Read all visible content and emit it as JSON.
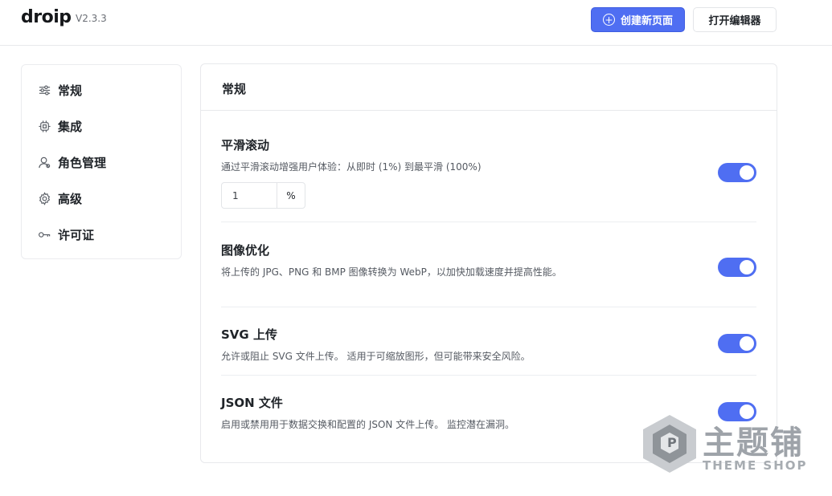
{
  "header": {
    "logo": "droip",
    "version": "V2.3.3",
    "create_page_label": "创建新页面",
    "open_editor_label": "打开编辑器"
  },
  "sidebar": {
    "items": [
      {
        "label": "常规",
        "icon": "sliders-icon"
      },
      {
        "label": "集成",
        "icon": "chip-icon"
      },
      {
        "label": "角色管理",
        "icon": "user-icon"
      },
      {
        "label": "高级",
        "icon": "gear-icon"
      },
      {
        "label": "许可证",
        "icon": "key-icon"
      }
    ]
  },
  "main": {
    "title": "常规",
    "settings": [
      {
        "title": "平滑滚动",
        "description": "通过平滑滚动增强用户体验：从即时 (1%) 到最平滑 (100%)",
        "enabled": true,
        "input_value": "1",
        "input_unit": "%"
      },
      {
        "title": "图像优化",
        "description": "将上传的 JPG、PNG 和 BMP 图像转换为 WebP，以加快加载速度并提高性能。",
        "enabled": true
      },
      {
        "title": "SVG 上传",
        "description": "允许或阻止 SVG 文件上传。 适用于可缩放图形，但可能带来安全风险。",
        "enabled": true
      },
      {
        "title": "JSON 文件",
        "description": "启用或禁用用于数据交换和配置的 JSON 文件上传。 监控潜在漏洞。",
        "enabled": true
      }
    ]
  },
  "watermark": {
    "text": "主题铺",
    "sub": "THEME SHOP"
  },
  "colors": {
    "accent": "#4f6ef2",
    "border": "#e8e9ec",
    "text": "#1f2328",
    "muted": "#555a62"
  }
}
